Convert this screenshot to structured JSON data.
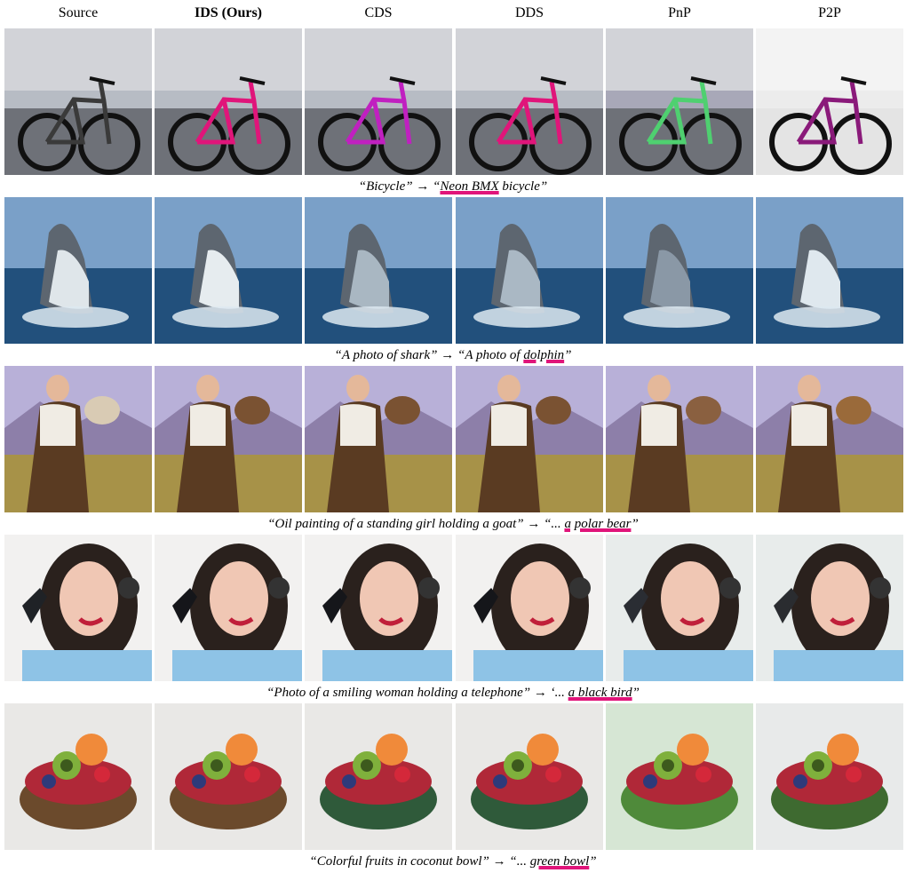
{
  "columns": [
    "Source",
    "IDS (Ours)",
    "CDS",
    "DDS",
    "PnP",
    "P2P"
  ],
  "rows": [
    {
      "scene": "bicycle",
      "caption_prefix": "“Bicycle” → “",
      "caption_highlight": "Neon BMX",
      "caption_suffix": " bicycle”",
      "accents": [
        "#3a3a3a",
        "#e0157a",
        "#c020c0",
        "#e0157a",
        "#4fd070",
        "#8a1a7a"
      ]
    },
    {
      "scene": "shark",
      "caption_prefix": "“A photo of shark” → “A photo of ",
      "caption_highlight": "dolphin",
      "caption_suffix": "”",
      "accents": [
        "#dfe6ea",
        "#e6ecef",
        "#a9b7c2",
        "#aab8c4",
        "#8a98a6",
        "#dfe8ee"
      ]
    },
    {
      "scene": "painting",
      "caption_prefix": "“Oil painting of a standing girl holding a goat” → “... ",
      "caption_highlight": "a polar bear",
      "caption_suffix": "”",
      "accents": [
        "#d9cbb4",
        "#7a5232",
        "#7a5232",
        "#7a5232",
        "#8a6040",
        "#9a6a3a"
      ]
    },
    {
      "scene": "woman",
      "caption_prefix": "“Photo of a smiling woman holding a telephone” → ‘... ",
      "caption_highlight": "a black bird",
      "caption_suffix": "”",
      "accents": [
        "#1f2226",
        "#15161a",
        "#15161a",
        "#15161a",
        "#2a2d33",
        "#2a2c30"
      ]
    },
    {
      "scene": "fruit",
      "caption_prefix": "“Colorful fruits in coconut bowl” → “... ",
      "caption_highlight": "green bowl",
      "caption_suffix": "”",
      "accents": [
        "#6b4a2c",
        "#6b4a2c",
        "#2f5a3a",
        "#2f5a3a",
        "#4f8a3a",
        "#3e6a30"
      ]
    }
  ]
}
